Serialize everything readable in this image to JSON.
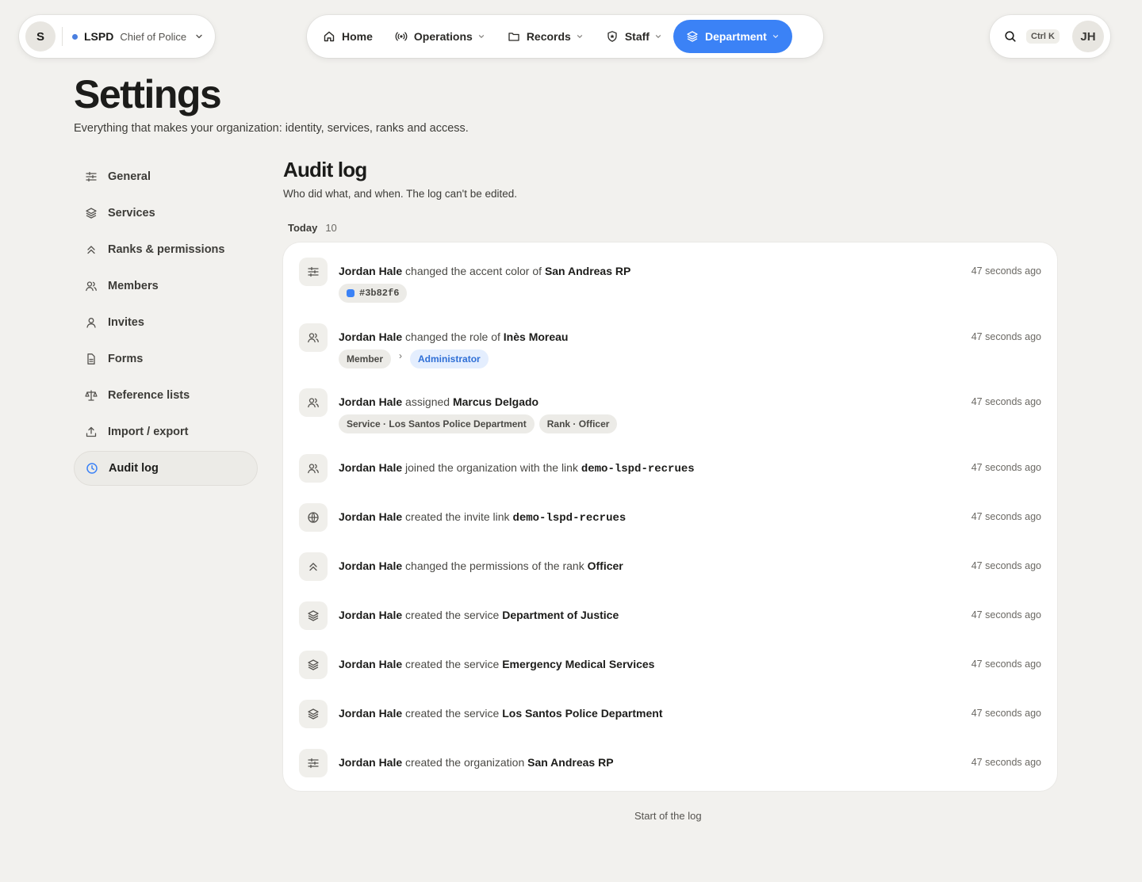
{
  "org": {
    "avatar": "S",
    "name": "LSPD",
    "role": "Chief of Police"
  },
  "nav": {
    "home": "Home",
    "operations": "Operations",
    "records": "Records",
    "staff": "Staff",
    "department": "Department"
  },
  "tools": {
    "shortcut": "Ctrl K",
    "user_initials": "JH"
  },
  "page": {
    "title": "Settings",
    "subtitle": "Everything that makes your organization: identity, services, ranks and access."
  },
  "sidebar": {
    "items": [
      {
        "label": "General",
        "icon": "sliders-icon"
      },
      {
        "label": "Services",
        "icon": "layers-icon"
      },
      {
        "label": "Ranks & permissions",
        "icon": "chevrons-up-icon"
      },
      {
        "label": "Members",
        "icon": "users-icon"
      },
      {
        "label": "Invites",
        "icon": "user-icon"
      },
      {
        "label": "Forms",
        "icon": "file-icon"
      },
      {
        "label": "Reference lists",
        "icon": "scale-icon"
      },
      {
        "label": "Import / export",
        "icon": "upload-icon"
      },
      {
        "label": "Audit log",
        "icon": "clock-icon",
        "active": true
      }
    ]
  },
  "section": {
    "title": "Audit log",
    "subtitle": "Who did what, and when. The log can't be edited.",
    "group_label": "Today",
    "group_count": "10"
  },
  "accent_color": "#3b82f6",
  "log": [
    {
      "actor": "Jordan Hale",
      "action": "changed the accent color of",
      "target": "San Andreas RP",
      "time": "47 seconds ago",
      "icon": "sliders-icon",
      "color_chip": "#3b82f6"
    },
    {
      "actor": "Jordan Hale",
      "action": "changed the role of",
      "target": "Inès Moreau",
      "time": "47 seconds ago",
      "icon": "users-icon",
      "from": "Member",
      "to": "Administrator"
    },
    {
      "actor": "Jordan Hale",
      "action": "assigned",
      "target": "Marcus Delgado",
      "time": "47 seconds ago",
      "icon": "users-icon",
      "chips": [
        "Service · Los Santos Police Department",
        "Rank · Officer"
      ]
    },
    {
      "actor": "Jordan Hale",
      "action": "joined the organization with the link",
      "target": "demo-lspd-recrues",
      "time": "47 seconds ago",
      "icon": "users-icon"
    },
    {
      "actor": "Jordan Hale",
      "action": "created the invite link",
      "target": "demo-lspd-recrues",
      "time": "47 seconds ago",
      "icon": "globe-icon"
    },
    {
      "actor": "Jordan Hale",
      "action": "changed the permissions of the rank",
      "target": "Officer",
      "time": "47 seconds ago",
      "icon": "chevrons-up-icon"
    },
    {
      "actor": "Jordan Hale",
      "action": "created the service",
      "target": "Department of Justice",
      "time": "47 seconds ago",
      "icon": "layers-icon"
    },
    {
      "actor": "Jordan Hale",
      "action": "created the service",
      "target": "Emergency Medical Services",
      "time": "47 seconds ago",
      "icon": "layers-icon"
    },
    {
      "actor": "Jordan Hale",
      "action": "created the service",
      "target": "Los Santos Police Department",
      "time": "47 seconds ago",
      "icon": "layers-icon"
    },
    {
      "actor": "Jordan Hale",
      "action": "created the organization",
      "target": "San Andreas RP",
      "time": "47 seconds ago",
      "icon": "sliders-icon"
    }
  ],
  "log_end": "Start of the log"
}
